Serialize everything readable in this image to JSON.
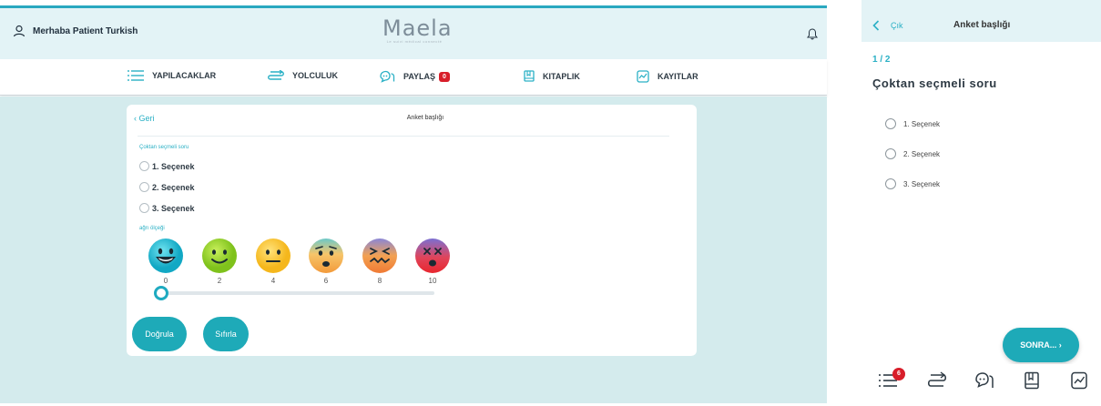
{
  "header": {
    "greeting": "Merhaba Patient Turkish",
    "logo_text": "Maela",
    "logo_subtitle": "Le suivi médical connecté"
  },
  "nav": {
    "items": [
      {
        "label": "YAPILACAKLAR",
        "icon": "list-icon"
      },
      {
        "label": "YOLCULUK",
        "icon": "route-icon"
      },
      {
        "label": "PAYLAŞ",
        "icon": "chat-icon",
        "badge": "0"
      },
      {
        "label": "KITAPLIK",
        "icon": "book-icon"
      },
      {
        "label": "KAYITLAR",
        "icon": "chart-icon"
      }
    ]
  },
  "survey": {
    "back_label": "Geri",
    "title": "Anket başlığı",
    "question_label": "Çoktan seçmeli soru",
    "options": [
      "1. Seçenek",
      "2. Seçenek",
      "3. Seçenek"
    ],
    "pain_scale_label": "ağrı ölçeği",
    "pain_values": [
      "0",
      "2",
      "4",
      "6",
      "8",
      "10"
    ],
    "selected_value": 0,
    "validate_label": "Doğrula",
    "reset_label": "Sıfırla"
  },
  "mobile": {
    "back_label": "Çık",
    "title": "Anket başlığı",
    "step": "1 / 2",
    "question": "Çoktan seçmeli soru",
    "options": [
      "1. Seçenek",
      "2. Seçenek",
      "3. Seçenek"
    ],
    "next_label": "SONRA... ›",
    "bottom_nav_badge": "6"
  },
  "colors": {
    "accent": "#1eaab8",
    "header_bg": "#e3f3f6",
    "content_bg": "#d4ebed",
    "badge": "#d81e2a"
  }
}
